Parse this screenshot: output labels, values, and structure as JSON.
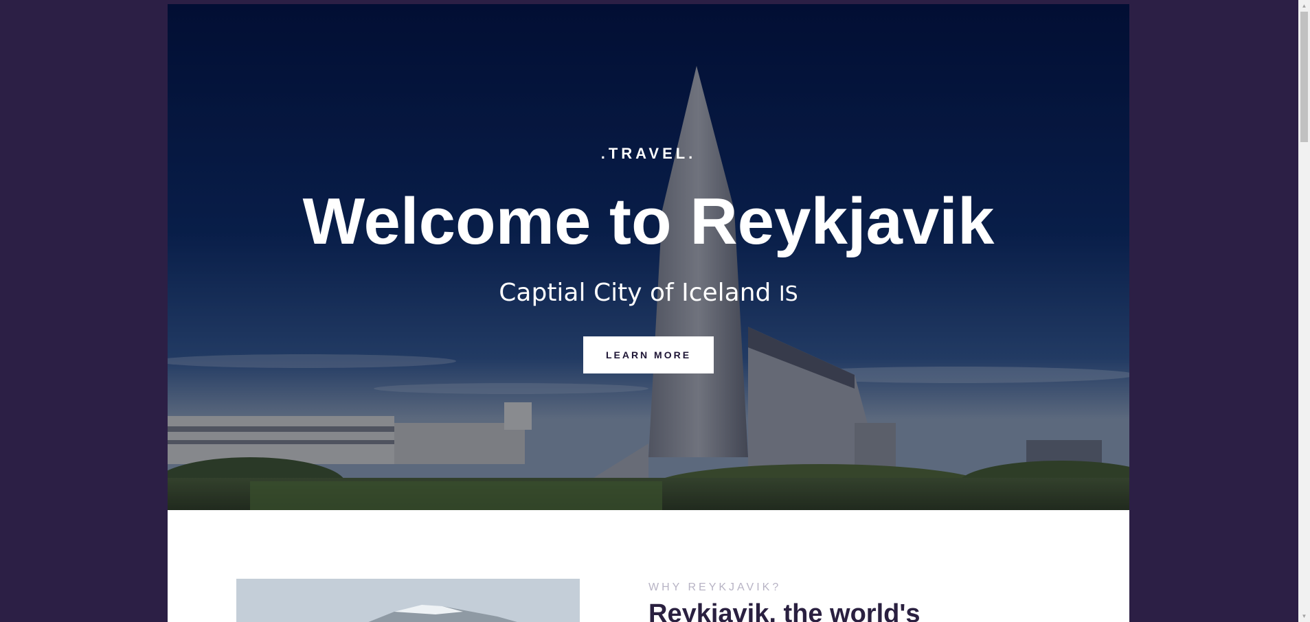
{
  "hero": {
    "eyebrow": ".TRAVEL.",
    "title": "Welcome to Reykjavik",
    "subtitle": "Captial City of Iceland",
    "flag_text": "IS",
    "cta_label": "LEARN MORE"
  },
  "about": {
    "eyebrow": "WHY REYKJAVIK?",
    "heading": "Reykjavik, the world's"
  },
  "colors": {
    "page_background": "#2c1f45",
    "hero_sky": "#031137",
    "cta_text": "#1e1535",
    "heading_text": "#2a2040",
    "eyebrow_muted": "#b7b3c4"
  },
  "icons": {
    "scroll_up": "chevron-up-icon",
    "scroll_down": "chevron-down-icon"
  }
}
